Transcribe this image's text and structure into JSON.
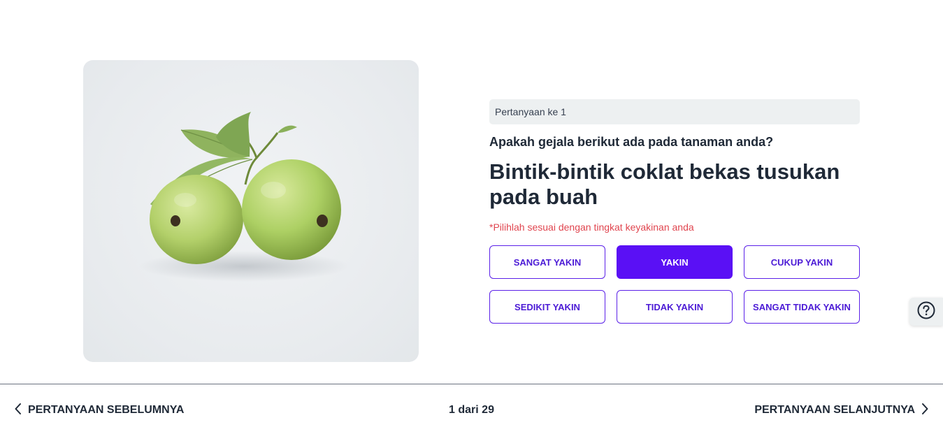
{
  "question": {
    "number_label": "Pertanyaan ke 1",
    "prompt": "Apakah gejala berikut ada pada tanaman anda?",
    "symptom": "Bintik-bintik coklat bekas tusukan pada buah",
    "hint": "*Pilihlah sesuai dengan tingkat keyakinan anda",
    "options": [
      {
        "label": "SANGAT YAKIN",
        "selected": false
      },
      {
        "label": "YAKIN",
        "selected": true
      },
      {
        "label": "CUKUP YAKIN",
        "selected": false
      },
      {
        "label": "SEDIKIT YAKIN",
        "selected": false
      },
      {
        "label": "TIDAK YAKIN",
        "selected": false
      },
      {
        "label": "SANGAT TIDAK YAKIN",
        "selected": false
      }
    ]
  },
  "image": {
    "subject": "two-guava-fruits-with-leaves"
  },
  "navigation": {
    "previous_label": "PERTANYAAN SEBELUMNYA",
    "next_label": "PERTANYAAN SELANJUTNYA",
    "progress": "1 dari 29"
  },
  "icons": {
    "prev": "chevron-left-icon",
    "next": "chevron-right-icon",
    "help": "question-circle-icon"
  },
  "colors": {
    "accent": "#5a10f5",
    "option_border": "#5b21e8",
    "hint": "#e0454f",
    "text": "#1f2937"
  }
}
